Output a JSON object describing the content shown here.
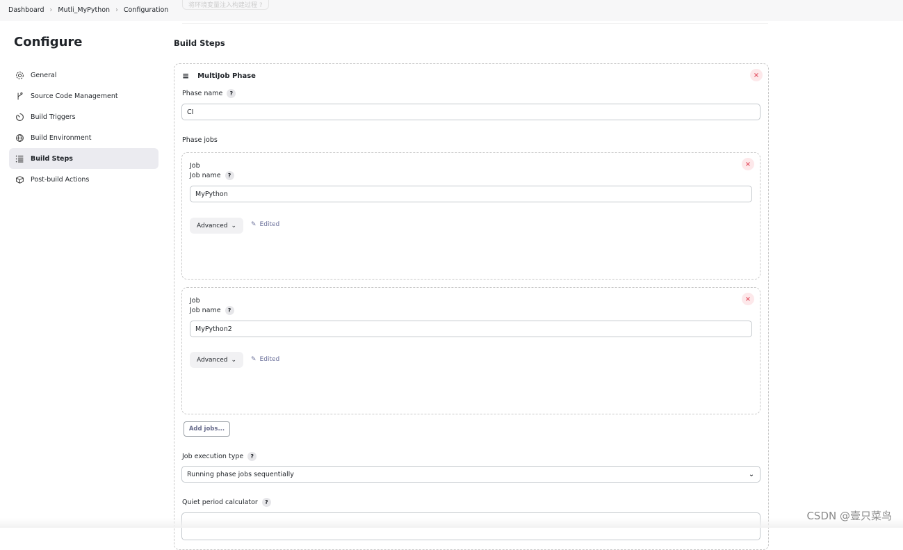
{
  "breadcrumb": [
    "Dashboard",
    "Mutli_MyPython",
    "Configuration"
  ],
  "ghost_text": "将环境变量注入构建过程",
  "page_title": "Configure",
  "sidebar": {
    "items": [
      {
        "label": "General",
        "icon": "gear-icon"
      },
      {
        "label": "Source Code Management",
        "icon": "branch-icon"
      },
      {
        "label": "Build Triggers",
        "icon": "timer-icon"
      },
      {
        "label": "Build Environment",
        "icon": "globe-icon"
      },
      {
        "label": "Build Steps",
        "icon": "list-icon",
        "active": true
      },
      {
        "label": "Post-build Actions",
        "icon": "package-icon"
      }
    ]
  },
  "section_title": "Build Steps",
  "phase": {
    "title": "MultiJob Phase",
    "phase_name_label": "Phase name",
    "phase_name_value": "CI",
    "phase_jobs_label": "Phase jobs",
    "jobs": [
      {
        "heading": "Job",
        "name_label": "Job name",
        "value": "MyPython",
        "advanced": "Advanced",
        "edited": "Edited"
      },
      {
        "heading": "Job",
        "name_label": "Job name",
        "value": "MyPython2",
        "advanced": "Advanced",
        "edited": "Edited"
      }
    ],
    "add_jobs": "Add jobs...",
    "exec_type_label": "Job execution type",
    "exec_type_value": "Running phase jobs sequentially",
    "quiet_label": "Quiet period calculator"
  },
  "help": "?",
  "watermark": "CSDN @壹只菜鸟"
}
